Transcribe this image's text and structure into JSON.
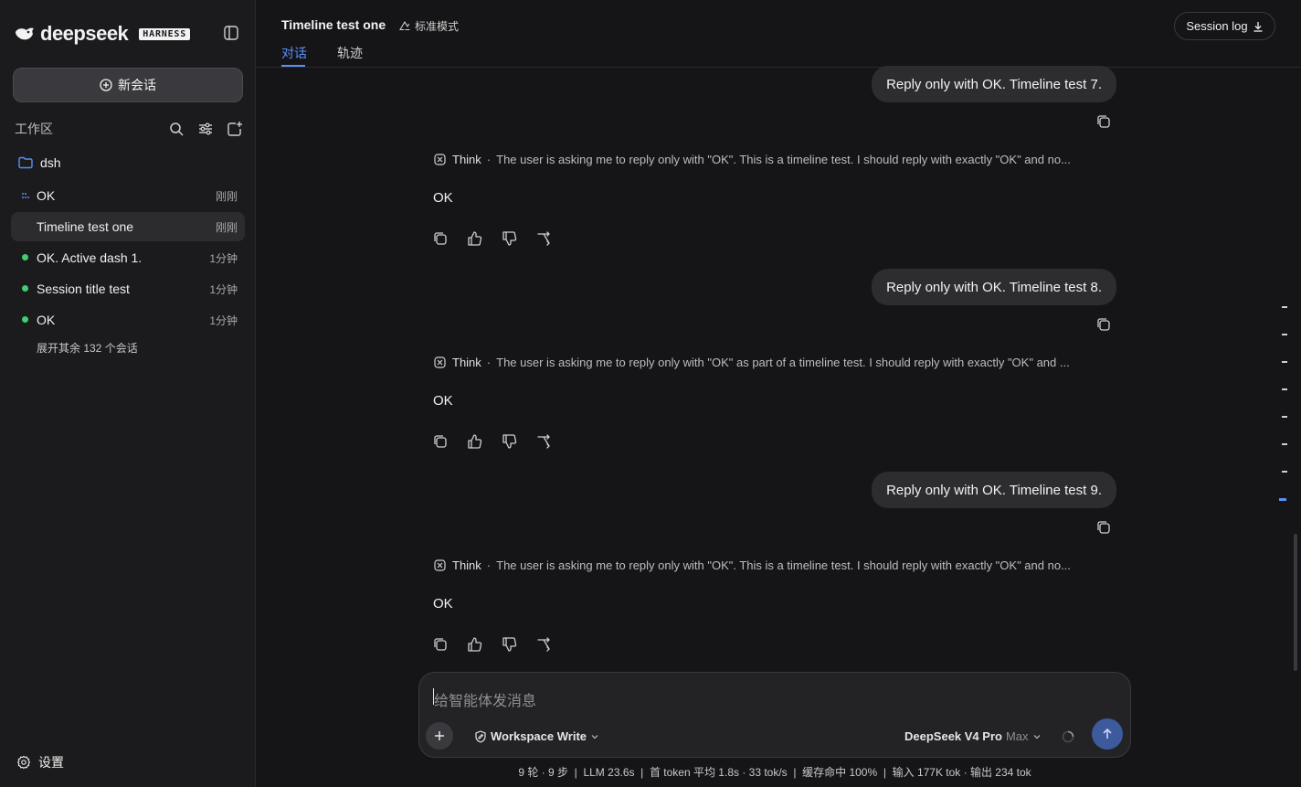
{
  "brand": {
    "name": "deepseek",
    "badge": "HARNESS"
  },
  "sidebar": {
    "new_chat_label": "新会话",
    "workspace_label": "工作区",
    "folder_name": "dsh",
    "sessions": [
      {
        "title": "OK",
        "time": "刚刚",
        "status": "running"
      },
      {
        "title": "Timeline test one",
        "time": "刚刚",
        "status": "active"
      },
      {
        "title": "OK. Active dash 1.",
        "time": "1分钟",
        "status": "done"
      },
      {
        "title": "Session title test",
        "time": "1分钟",
        "status": "done"
      },
      {
        "title": "OK",
        "time": "1分钟",
        "status": "done"
      }
    ],
    "more_label": "展开其余 132 个会话",
    "settings_label": "设置"
  },
  "header": {
    "title": "Timeline test one",
    "mode_label": "标准模式",
    "tabs": [
      {
        "label": "对话",
        "active": true
      },
      {
        "label": "轨迹",
        "active": false
      }
    ],
    "session_log_label": "Session log"
  },
  "messages": [
    {
      "user": "Reply only with OK. Timeline test 7.",
      "think_label": "Think",
      "think": "The user is asking me to reply only with \"OK\". This is a timeline test. I should reply with exactly \"OK\" and no...",
      "answer": "OK"
    },
    {
      "user": "Reply only with OK. Timeline test 8.",
      "think_label": "Think",
      "think": "The user is asking me to reply only with \"OK\" as part of a timeline test. I should reply with exactly \"OK\" and ...",
      "answer": "OK"
    },
    {
      "user": "Reply only with OK. Timeline test 9.",
      "think_label": "Think",
      "think": "The user is asking me to reply only with \"OK\". This is a timeline test. I should reply with exactly \"OK\" and no...",
      "answer": "OK"
    }
  ],
  "composer": {
    "placeholder": "给智能体发消息",
    "workspace_mode": "Workspace Write",
    "model": "DeepSeek V4 Pro",
    "level": "Max"
  },
  "stats": {
    "text": "9 轮 · 9 步  |  LLM 23.6s  |  首 token 平均 1.8s · 33 tok/s  |  缓存命中 100%  |  输入 177K tok · 输出 234 tok"
  },
  "colors": {
    "accent": "#5b8ff9",
    "online": "#3ecf6e",
    "background": "#151517",
    "sidebar": "#1b1b1d"
  }
}
